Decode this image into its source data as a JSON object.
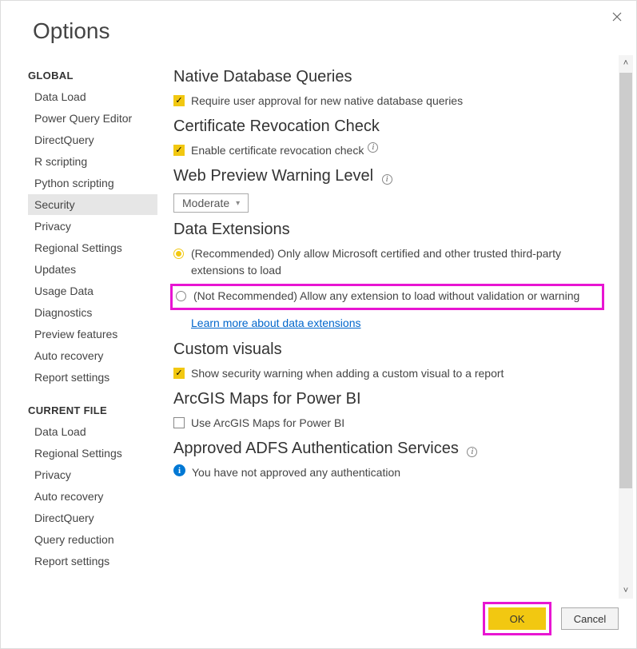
{
  "window": {
    "title": "Options"
  },
  "sidebar": {
    "groups": [
      {
        "title": "GLOBAL",
        "items": [
          {
            "label": "Data Load"
          },
          {
            "label": "Power Query Editor"
          },
          {
            "label": "DirectQuery"
          },
          {
            "label": "R scripting"
          },
          {
            "label": "Python scripting"
          },
          {
            "label": "Security",
            "selected": true
          },
          {
            "label": "Privacy"
          },
          {
            "label": "Regional Settings"
          },
          {
            "label": "Updates"
          },
          {
            "label": "Usage Data"
          },
          {
            "label": "Diagnostics"
          },
          {
            "label": "Preview features"
          },
          {
            "label": "Auto recovery"
          },
          {
            "label": "Report settings"
          }
        ]
      },
      {
        "title": "CURRENT FILE",
        "items": [
          {
            "label": "Data Load"
          },
          {
            "label": "Regional Settings"
          },
          {
            "label": "Privacy"
          },
          {
            "label": "Auto recovery"
          },
          {
            "label": "DirectQuery"
          },
          {
            "label": "Query reduction"
          },
          {
            "label": "Report settings"
          }
        ]
      }
    ]
  },
  "content": {
    "native_db": {
      "title": "Native Database Queries",
      "chk1": "Require user approval for new native database queries"
    },
    "cert": {
      "title": "Certificate Revocation Check",
      "chk1": "Enable certificate revocation check"
    },
    "web": {
      "title": "Web Preview Warning Level",
      "selected": "Moderate"
    },
    "data_ext": {
      "title": "Data Extensions",
      "opt1": "(Recommended) Only allow Microsoft certified and other trusted third-party extensions to load",
      "opt2": "(Not Recommended) Allow any extension to load without validation or warning",
      "link": "Learn more about data extensions"
    },
    "custom_visuals": {
      "title": "Custom visuals",
      "chk1": "Show security warning when adding a custom visual to a report"
    },
    "arcgis": {
      "title": "ArcGIS Maps for Power BI",
      "chk1": "Use ArcGIS Maps for Power BI"
    },
    "adfs": {
      "title": "Approved ADFS Authentication Services",
      "msg": "You have not approved any authentication"
    }
  },
  "footer": {
    "ok": "OK",
    "cancel": "Cancel"
  }
}
